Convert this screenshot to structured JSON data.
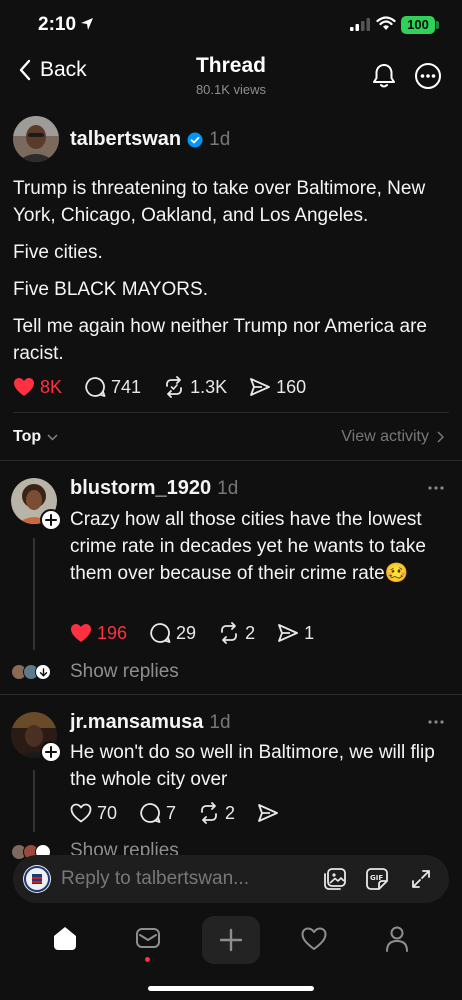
{
  "status_bar": {
    "time": "2:10",
    "battery": "100"
  },
  "header": {
    "back_label": "Back",
    "title": "Thread",
    "subtitle": "80.1K views"
  },
  "post": {
    "username": "talbertswan",
    "age": "1d",
    "paragraphs": [
      "Trump is threatening to take over Baltimore, New York, Chicago, Oakland, and Los Angeles.",
      "Five cities.",
      "Five BLACK MAYORS.",
      "Tell me again how neither Trump nor America are racist."
    ],
    "likes": "8K",
    "comments": "741",
    "reposts": "1.3K",
    "shares": "160"
  },
  "sort": {
    "label": "Top",
    "activity_label": "View activity"
  },
  "replies": [
    {
      "username": "blustorm_1920",
      "age": "1d",
      "text": "Crazy how all those cities have the lowest crime rate in decades yet he wants to take them over because of their crime rate",
      "emoji": "🥴",
      "likes": "196",
      "comments": "29",
      "reposts": "2",
      "shares": "1",
      "show_replies": "Show replies"
    },
    {
      "username": "jr.mansamusa",
      "age": "1d",
      "text": "He won't do so well in Baltimore, we will flip the whole city over",
      "likes": "70",
      "comments": "7",
      "reposts": "2",
      "show_replies": "Show replies"
    }
  ],
  "composer": {
    "placeholder": "Reply to talbertswan..."
  },
  "colors": {
    "background": "#101010",
    "like_red": "#ff3040",
    "verified_blue": "#0095f6",
    "battery_green": "#30d158"
  }
}
